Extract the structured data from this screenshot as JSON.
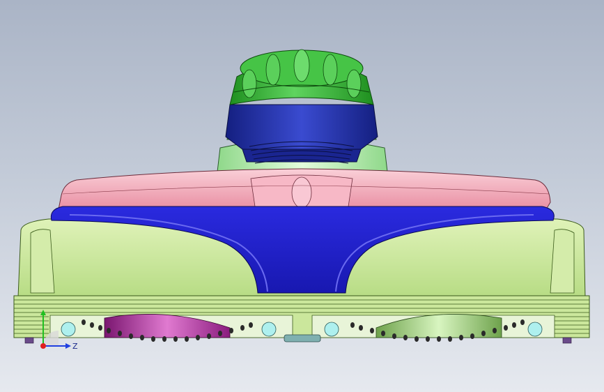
{
  "viewport": {
    "background_top": "#aab4c6",
    "background_bottom": "#e6e9ef"
  },
  "triad": {
    "x_label": "",
    "y_label": "",
    "z_label": "Z",
    "x_color": "#e02020",
    "y_color": "#20c020",
    "z_color": "#2040e0"
  },
  "model": {
    "cap_color": "#33b833",
    "nut_color": "#2233aa",
    "neck_color": "#b8f0b0",
    "top_shell_color": "#f4a9b8",
    "front_shell_color": "#2a2adf",
    "body_color": "#c8e89a",
    "left_brush_color": "#b02a9a",
    "right_brush_color": "#9fcf88",
    "wheel_color": "#aef0ee",
    "bristle_color": "#2a2a2a"
  }
}
